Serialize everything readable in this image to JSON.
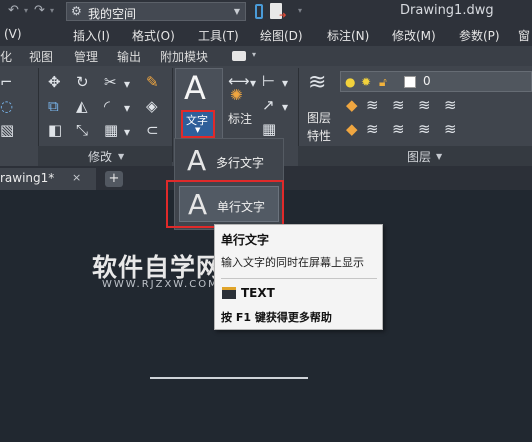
{
  "title_bar": {
    "workspace": "我的空间",
    "document_title": "Drawing1.dwg",
    "icons": [
      "undo-arrow-icon",
      "redo-arrow-icon",
      "gear-icon",
      "phone-icon",
      "export-doc-icon"
    ]
  },
  "menu": {
    "items": [
      "(V)",
      "插入(I)",
      "格式(O)",
      "工具(T)",
      "绘图(D)",
      "标注(N)",
      "修改(M)",
      "参数(P)",
      "窗"
    ]
  },
  "ribbon_tabs": {
    "items": [
      "化",
      "视图",
      "管理",
      "输出",
      "附加模块"
    ]
  },
  "ribbon": {
    "text_tool": {
      "letter": "A",
      "label": "文字"
    },
    "annotate_label": "标注",
    "layer_label": "图层",
    "layer_props_label": "特性",
    "layer_value": "0",
    "panel_modify": "修改",
    "panel_layers": "图层"
  },
  "file_tabs": {
    "active": "rawing1*",
    "close": "×",
    "new": "+"
  },
  "text_menu": {
    "multiline": {
      "letter": "A",
      "label": "多行文字"
    },
    "singleline": {
      "letter": "A",
      "label": "单行文字"
    }
  },
  "tooltip": {
    "title": "单行文字",
    "description": "输入文字的同时在屏幕上显示",
    "command": "TEXT",
    "help": "按 F1 键获得更多帮助"
  },
  "watermark": {
    "cn": "软件自学网",
    "en": "WWW.RJZXW.COM"
  },
  "colors": {
    "highlight_border": "#e02a2a",
    "accent_blue": "#2f5f9a",
    "canvas_bg": "#212830"
  }
}
